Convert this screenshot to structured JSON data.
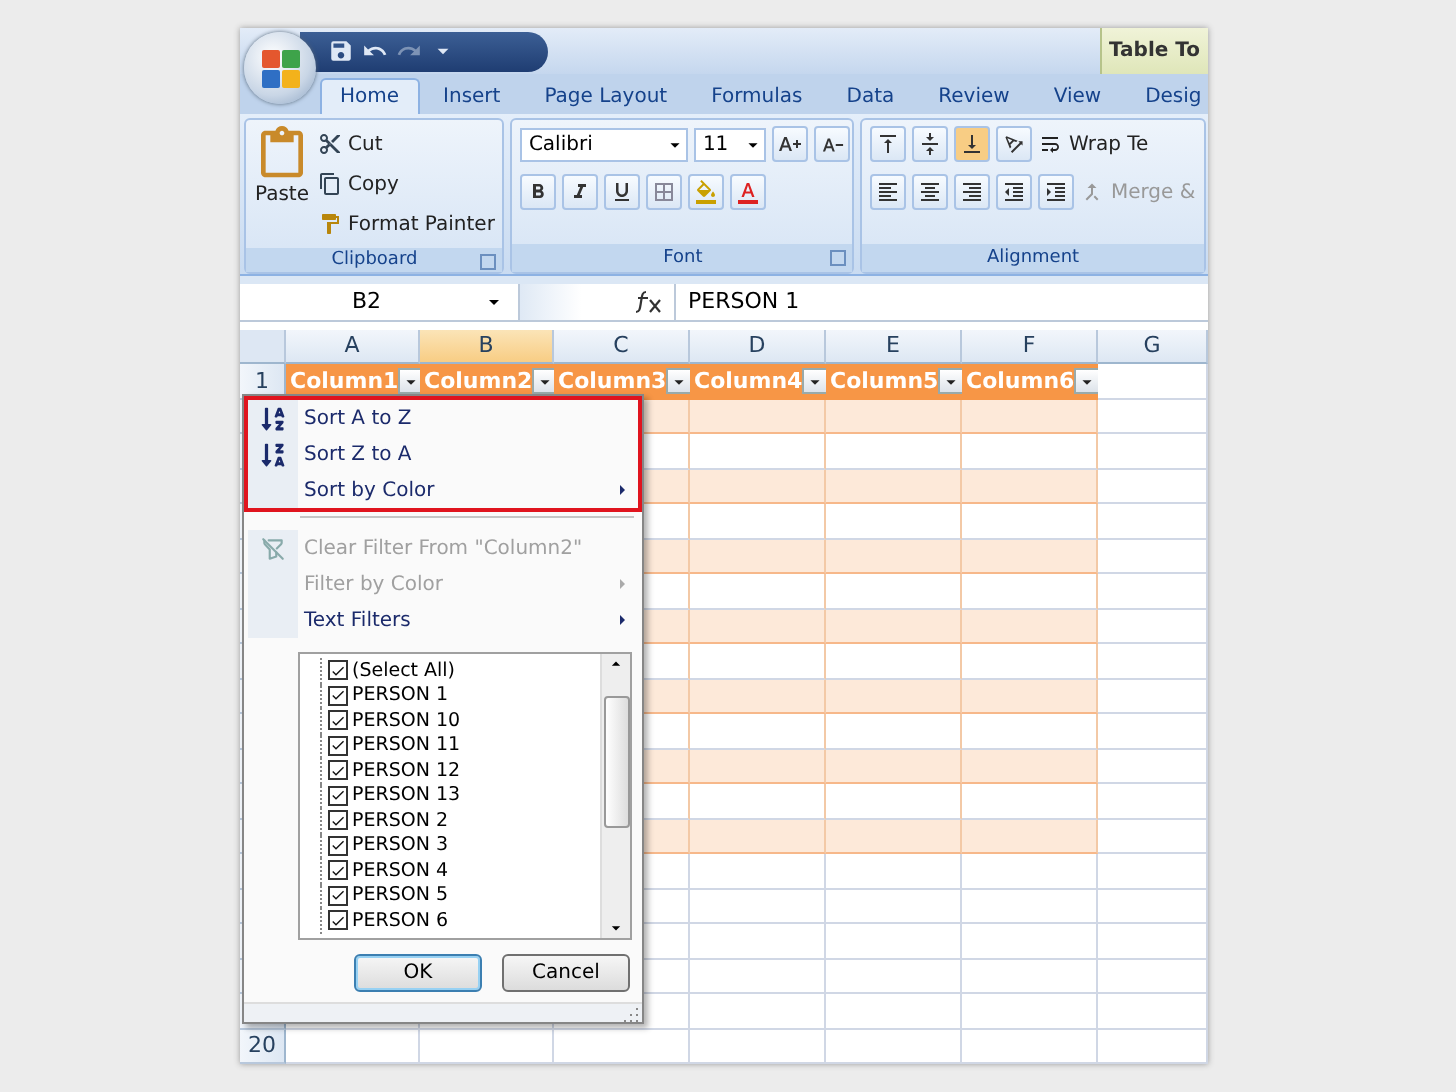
{
  "title_bar": {
    "context_title": "Table To"
  },
  "tabs": [
    {
      "label": "Home",
      "selected": true
    },
    {
      "label": "Insert",
      "selected": false
    },
    {
      "label": "Page Layout",
      "selected": false
    },
    {
      "label": "Formulas",
      "selected": false
    },
    {
      "label": "Data",
      "selected": false
    },
    {
      "label": "Review",
      "selected": false
    },
    {
      "label": "View",
      "selected": false
    },
    {
      "label": "Desig",
      "selected": false
    }
  ],
  "ribbon": {
    "clipboard": {
      "paste": "Paste",
      "cut": "Cut",
      "copy": "Copy",
      "format_painter": "Format Painter",
      "label": "Clipboard"
    },
    "font": {
      "font_name": "Calibri",
      "font_size": "11",
      "label": "Font"
    },
    "alignment": {
      "wrap_text": "Wrap Te",
      "merge": "Merge &",
      "label": "Alignment"
    }
  },
  "formula_bar": {
    "name_box": "B2",
    "formula": "PERSON 1"
  },
  "columns": [
    {
      "label": "A",
      "selected": false
    },
    {
      "label": "B",
      "selected": true
    },
    {
      "label": "C",
      "selected": false
    },
    {
      "label": "D",
      "selected": false
    },
    {
      "label": "E",
      "selected": false
    },
    {
      "label": "F",
      "selected": false
    },
    {
      "label": "G",
      "selected": false
    }
  ],
  "header_cells": [
    "Column1",
    "Column2",
    "Column3",
    "Column4",
    "Column5",
    "Column6"
  ],
  "rows": [
    {
      "number": "1",
      "kind": "header"
    },
    {
      "kind": "band"
    },
    {
      "kind": "plain"
    },
    {
      "kind": "band"
    },
    {
      "kind": "plain"
    },
    {
      "kind": "band"
    },
    {
      "kind": "plain"
    },
    {
      "kind": "band"
    },
    {
      "kind": "plain"
    },
    {
      "kind": "band"
    },
    {
      "kind": "plain"
    },
    {
      "kind": "band"
    },
    {
      "kind": "plain"
    },
    {
      "kind": "band"
    },
    {
      "kind": "empty"
    },
    {
      "kind": "empty"
    },
    {
      "kind": "empty"
    },
    {
      "kind": "empty"
    },
    {
      "kind": "empty"
    },
    {
      "number": "20",
      "kind": "empty"
    }
  ],
  "filter_menu": {
    "sections": [
      {
        "highlighted": true,
        "items": [
          {
            "label": "Sort A to Z",
            "kind": "sort_asc",
            "disabled": false,
            "submenu": false
          },
          {
            "label": "Sort Z to A",
            "kind": "sort_desc",
            "disabled": false,
            "submenu": false
          },
          {
            "label": "Sort by Color",
            "kind": "plain",
            "disabled": false,
            "submenu": true
          }
        ]
      },
      {
        "highlighted": false,
        "items": [
          {
            "label": "Clear Filter From \"Column2\"",
            "kind": "clear",
            "disabled": true,
            "submenu": false
          },
          {
            "label": "Filter by Color",
            "kind": "plain",
            "disabled": true,
            "submenu": true
          },
          {
            "label": "Text Filters",
            "kind": "plain",
            "disabled": false,
            "submenu": true
          }
        ]
      }
    ],
    "values": [
      {
        "label": "(Select All)",
        "checked": true
      },
      {
        "label": "PERSON 1",
        "checked": true
      },
      {
        "label": "PERSON 10",
        "checked": true
      },
      {
        "label": "PERSON 11",
        "checked": true
      },
      {
        "label": "PERSON 12",
        "checked": true
      },
      {
        "label": "PERSON 13",
        "checked": true
      },
      {
        "label": "PERSON 2",
        "checked": true
      },
      {
        "label": "PERSON 3",
        "checked": true
      },
      {
        "label": "PERSON 4",
        "checked": true
      },
      {
        "label": "PERSON 5",
        "checked": true
      },
      {
        "label": "PERSON 6",
        "checked": true
      }
    ],
    "buttons": [
      {
        "label": "OK",
        "kind": "default"
      },
      {
        "label": "Cancel",
        "kind": "normal"
      }
    ]
  }
}
